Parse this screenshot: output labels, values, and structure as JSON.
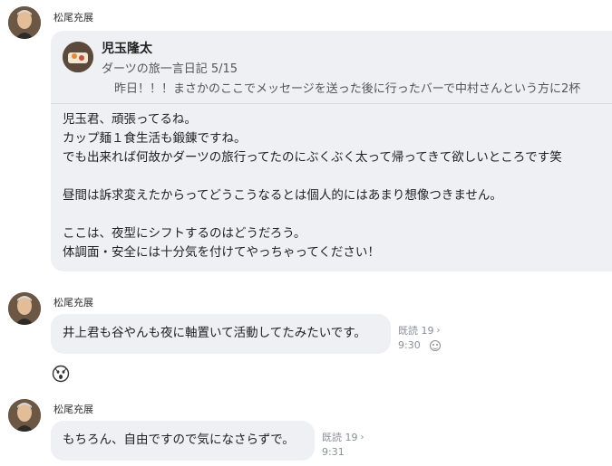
{
  "messages": [
    {
      "sender": "松尾充展",
      "quote": {
        "name": "児玉隆太",
        "subtitle": "ダーツの旅一言日記 5/15",
        "preview": "昨日！！！まさかのここでメッセージを送った後に行ったバーで中村さんという方に2杯"
      },
      "lines": [
        "児玉君、頑張ってるね。",
        "カップ麺１食生活も鍛錬ですね。",
        "でも出来れば何故かダーツの旅行ってたのにぶくぶく太って帰ってきて欲しいところです笑",
        "",
        "昼間は訴求変えたからってどうこうなるとは個人的にはあまり想像つきません。",
        "",
        "ここは、夜型にシフトするのはどうだろう。",
        "体調面・安全には十分気を付けてやっちゃってください！"
      ]
    },
    {
      "sender": "松尾充展",
      "text": "井上君も谷やんも夜に軸置いて活動してたみたいです。",
      "read": "既読 19",
      "time": "9:30"
    },
    {
      "sender": "松尾充展",
      "text": "もちろん、自由ですので気になさらずで。",
      "read": "既読 19",
      "time": "9:31"
    }
  ],
  "icons": {
    "chevron": "›",
    "reaction": "shocked-face-icon"
  },
  "colors": {
    "bubble": "#eef0f3",
    "meta": "#8a8f96"
  }
}
